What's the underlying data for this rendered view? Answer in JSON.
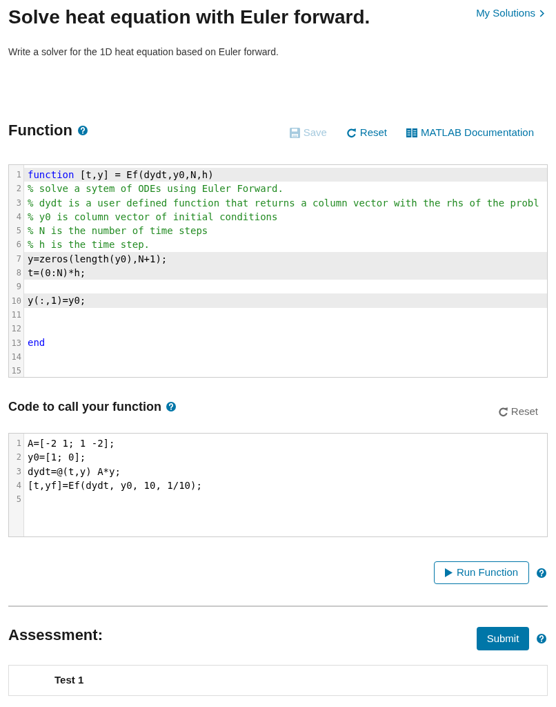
{
  "header": {
    "title": "Solve heat equation with Euler forward.",
    "my_solutions_link": "My Solutions"
  },
  "description": "Write a solver for the 1D heat equation based on Euler forward.",
  "function_section": {
    "heading": "Function",
    "toolbar": [
      {
        "kind": "save",
        "label": "Save",
        "disabled": true
      },
      {
        "kind": "reset",
        "label": "Reset",
        "disabled": false
      },
      {
        "kind": "documentation",
        "label": "MATLAB Documentation",
        "disabled": false
      }
    ],
    "editor": {
      "lines": [
        {
          "number": "1",
          "locked": true,
          "tokens": [
            {
              "kind": "keyword",
              "text": "function"
            },
            {
              "kind": "plain",
              "text": " [t,y] = Ef(dydt,y0,N,h)"
            }
          ]
        },
        {
          "number": "2",
          "locked": false,
          "tokens": [
            {
              "kind": "comment",
              "text": "% solve a sytem of ODEs using Euler Forward."
            }
          ]
        },
        {
          "number": "3",
          "locked": false,
          "tokens": [
            {
              "kind": "comment",
              "text": "% dydt is a user defined function that returns a column vector with the rhs of the probl"
            }
          ]
        },
        {
          "number": "4",
          "locked": false,
          "tokens": [
            {
              "kind": "comment",
              "text": "% y0 is column vector of initial conditions"
            }
          ]
        },
        {
          "number": "5",
          "locked": false,
          "tokens": [
            {
              "kind": "comment",
              "text": "% N is the number of time steps"
            }
          ]
        },
        {
          "number": "6",
          "locked": false,
          "tokens": [
            {
              "kind": "comment",
              "text": "% h is the time step."
            }
          ]
        },
        {
          "number": "7",
          "locked": true,
          "tokens": [
            {
              "kind": "plain",
              "text": "y=zeros(length(y0),N+1);"
            }
          ]
        },
        {
          "number": "8",
          "locked": true,
          "tokens": [
            {
              "kind": "plain",
              "text": "t=(0:N)*h;"
            }
          ]
        },
        {
          "number": "9",
          "locked": false
        },
        {
          "number": "10",
          "locked": true,
          "tokens": [
            {
              "kind": "plain",
              "text": "y(:,1)=y0;"
            }
          ]
        },
        {
          "number": "11",
          "locked": false
        },
        {
          "number": "12",
          "locked": false
        },
        {
          "number": "13",
          "locked": false,
          "tokens": [
            {
              "kind": "keyword",
              "text": "end"
            }
          ]
        },
        {
          "number": "14",
          "locked": false
        },
        {
          "number": "15",
          "locked": false
        }
      ]
    }
  },
  "call_section": {
    "heading": "Code to call your function",
    "reset_label": "Reset",
    "editor": {
      "lines": [
        {
          "number": "1",
          "locked": false,
          "tokens": [
            {
              "kind": "plain",
              "text": "A=[-2 1; 1 -2];"
            }
          ]
        },
        {
          "number": "2",
          "locked": false,
          "tokens": [
            {
              "kind": "plain",
              "text": "y0=[1; 0];"
            }
          ]
        },
        {
          "number": "3",
          "locked": false,
          "tokens": [
            {
              "kind": "plain",
              "text": "dydt=@(t,y) A*y;"
            }
          ]
        },
        {
          "number": "4",
          "locked": false,
          "tokens": [
            {
              "kind": "plain",
              "text": "[t,yf]=Ef(dydt, y0, 10, 1/10);"
            }
          ]
        },
        {
          "number": "5",
          "locked": false
        }
      ]
    }
  },
  "run_button": {
    "label": "Run Function"
  },
  "assessment": {
    "heading": "Assessment:",
    "submit_label": "Submit",
    "tests": [
      {
        "label": "Test 1"
      }
    ]
  }
}
